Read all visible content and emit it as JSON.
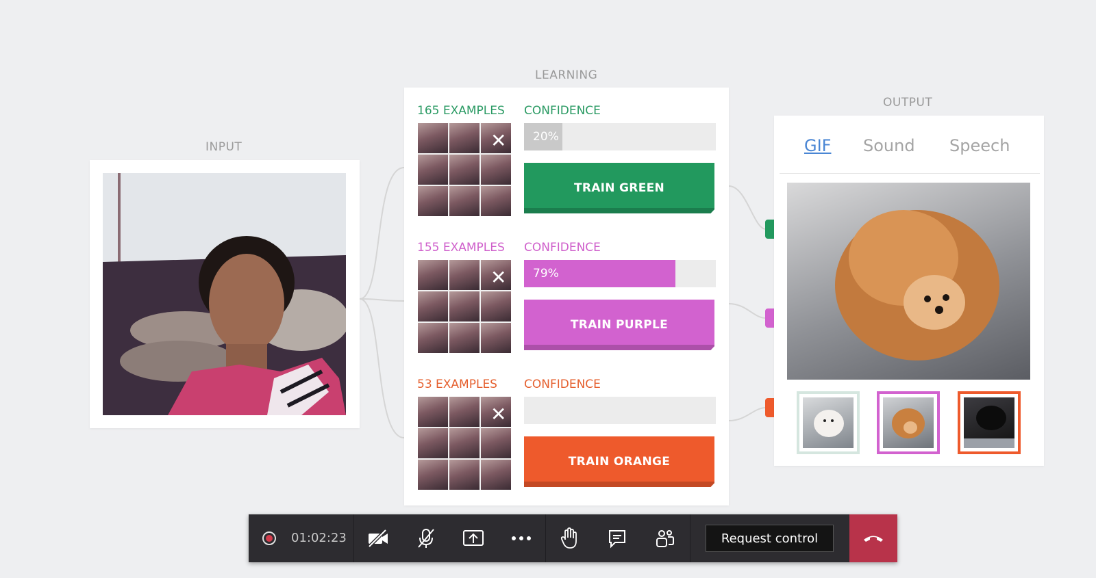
{
  "labels": {
    "input": "INPUT",
    "learning": "LEARNING",
    "output": "OUTPUT"
  },
  "classes": [
    {
      "examples": "165 EXAMPLES",
      "confidence_label": "CONFIDENCE",
      "confidence_value": 0.2,
      "confidence_text": "20%",
      "train_label": "TRAIN GREEN",
      "color": "#22995e",
      "text_color": "#2a9a63",
      "bar_color": "#c9c9c9"
    },
    {
      "examples": "155 EXAMPLES",
      "confidence_label": "CONFIDENCE",
      "confidence_value": 0.79,
      "confidence_text": "79%",
      "train_label": "TRAIN PURPLE",
      "color": "#d262cf",
      "text_color": "#cf5fcb",
      "bar_color": "#d262cf"
    },
    {
      "examples": "53 EXAMPLES",
      "confidence_label": "CONFIDENCE",
      "confidence_value": 0,
      "confidence_text": "",
      "train_label": "TRAIN ORANGE",
      "color": "#ee5a2c",
      "text_color": "#e5602f",
      "bar_color": "#ee5a2c"
    }
  ],
  "close_glyph": "✕",
  "output": {
    "tabs": [
      {
        "label": "GIF",
        "active": true
      },
      {
        "label": "Sound",
        "active": false
      },
      {
        "label": "Speech",
        "active": false
      }
    ],
    "thumb_colors": [
      "#d5e6df",
      "#d262cf",
      "#ee5a2c"
    ]
  },
  "meeting": {
    "timer": "01:02:23",
    "request_control": "Request control",
    "icons": [
      "record-icon",
      "camera-off-icon",
      "mic-off-icon",
      "share-screen-icon",
      "more-icon",
      "raise-hand-icon",
      "chat-icon",
      "participants-icon",
      "hang-up-icon"
    ]
  }
}
